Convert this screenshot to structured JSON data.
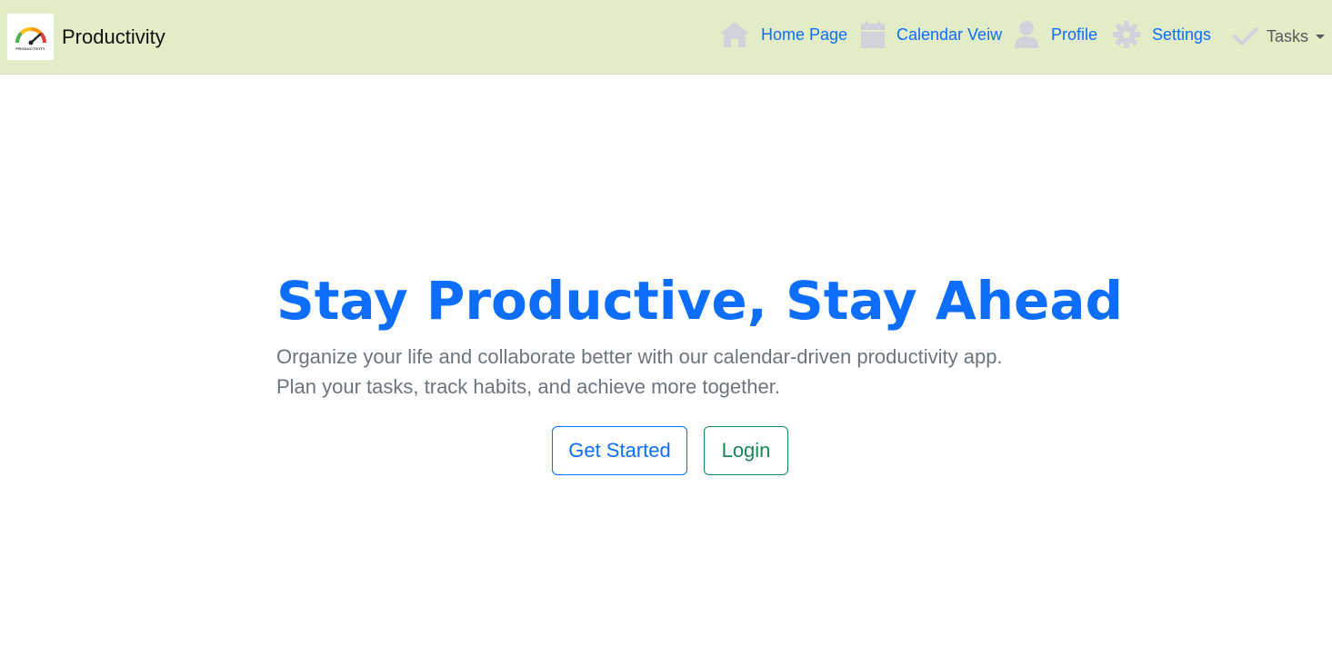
{
  "navbar": {
    "brand": {
      "name": "Productivity",
      "logo_caption": "PRODUCTIVITY",
      "logo_icon": "gauge-icon"
    },
    "items": [
      {
        "label": "Home Page",
        "icon": "home-icon"
      },
      {
        "label": "Calendar Veiw",
        "icon": "calendar-icon"
      },
      {
        "label": "Profile",
        "icon": "user-icon"
      },
      {
        "label": "Settings",
        "icon": "gear-icon"
      },
      {
        "label": "Tasks",
        "icon": "checkmark-icon",
        "dropdown": true
      }
    ],
    "background_color": "#e2edc8",
    "link_color": "#0d6efd",
    "icon_color": "#cfd3dc"
  },
  "hero": {
    "title": "Stay Productive, Stay Ahead",
    "subtitle": "Organize your life and collaborate better with our calendar-driven productivity app. Plan your tasks, track habits, and achieve more together.",
    "buttons": {
      "get_started": "Get Started",
      "login": "Login"
    },
    "title_color": "#0d6efd",
    "primary_color": "#0d6efd",
    "success_color": "#198754"
  }
}
